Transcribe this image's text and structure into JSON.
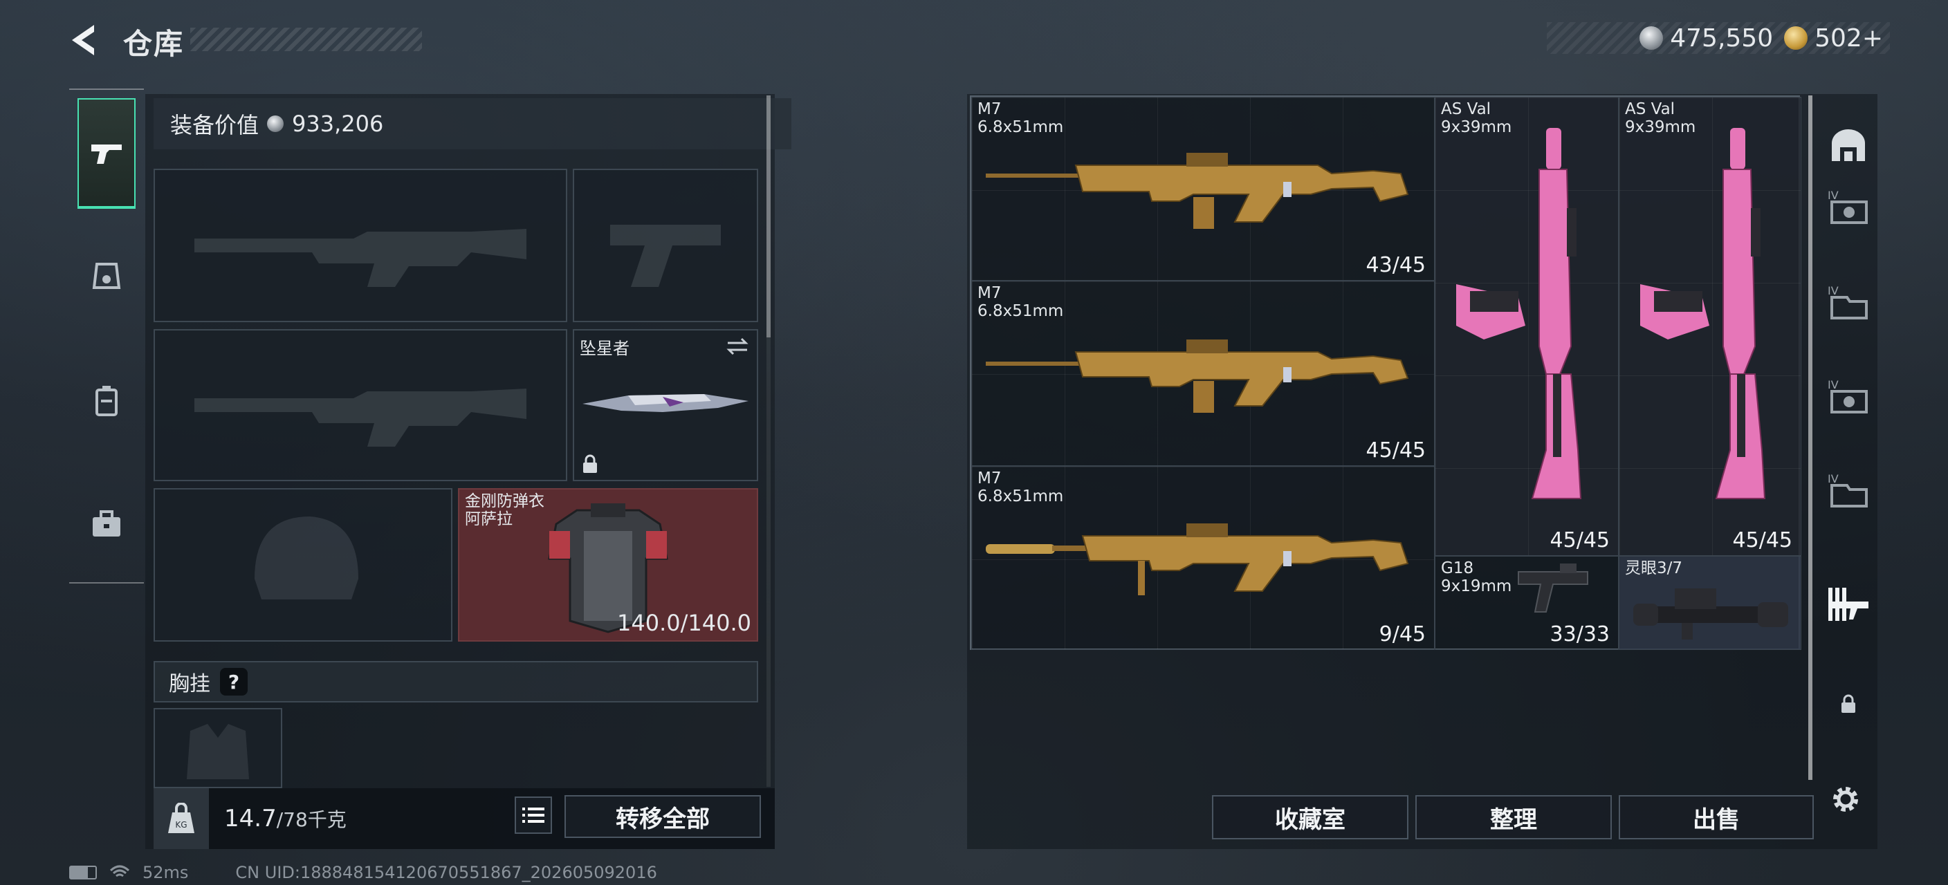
{
  "header": {
    "title": "仓库"
  },
  "currency": {
    "silver": "475,550",
    "gold": "502+"
  },
  "left": {
    "equip_value_label": "装备价值",
    "equip_value": "933,206",
    "melee": {
      "name": "坠星者"
    },
    "armor": {
      "name": "金刚防弹衣",
      "variant": "阿萨拉",
      "durability": "140.0/140.0"
    },
    "chest_rig_label": "胸挂",
    "chest_rig_help": "?",
    "weight_current": "14.7",
    "weight_max": "/78千克",
    "transfer_all": "转移全部",
    "tabs": [
      {
        "icon": "pistol-icon"
      },
      {
        "icon": "helmet-icon"
      },
      {
        "icon": "backpack-icon"
      },
      {
        "icon": "case-icon"
      }
    ]
  },
  "right": {
    "weapons": [
      {
        "name": "M7",
        "caliber": "6.8x51mm",
        "ammo": "43/45"
      },
      {
        "name": "M7",
        "caliber": "6.8x51mm",
        "ammo": "45/45"
      },
      {
        "name": "M7",
        "caliber": "6.8x51mm",
        "ammo": "9/45"
      },
      {
        "name": "AS Val",
        "caliber": "9x39mm",
        "ammo": "45/45"
      },
      {
        "name": "AS Val",
        "caliber": "9x39mm",
        "ammo": "45/45"
      },
      {
        "name": "G18",
        "caliber": "9x19mm",
        "ammo": "33/33"
      },
      {
        "name": "灵眼3/7",
        "caliber": "",
        "ammo": ""
      }
    ],
    "buttons": {
      "collection": "收藏室",
      "organize": "整理",
      "sell": "出售"
    },
    "side_tabs": [
      {
        "icon": "vault-icon"
      },
      {
        "icon": "storage-iv-icon"
      },
      {
        "icon": "storage-iv-icon"
      },
      {
        "icon": "storage-iv-icon"
      },
      {
        "icon": "storage-iv-icon"
      },
      {
        "icon": "weapon-storage-icon"
      },
      {
        "icon": "lock-icon"
      }
    ]
  },
  "status": {
    "ping": "52ms",
    "uid": "CN UID:18884815412067055186​7_202605092016"
  },
  "colors": {
    "accent": "#48e1b2",
    "armor_bg": "#5a2c30",
    "pink": "#e676b8",
    "gold": "#b58a3e"
  }
}
